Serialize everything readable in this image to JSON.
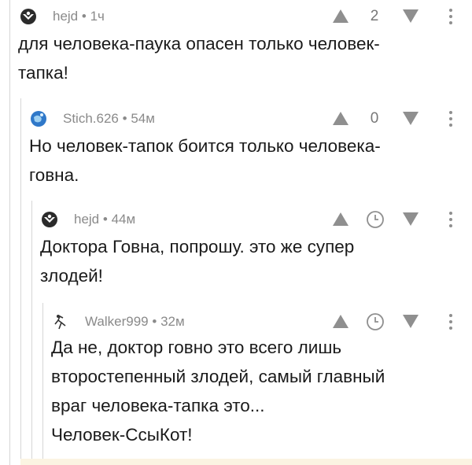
{
  "comments": [
    {
      "author": "hejd",
      "meta": "1ч",
      "rating": "2",
      "avatar": "dark-emblem",
      "lines": [
        "для человека-паука опасен только человек-",
        "тапка!"
      ]
    },
    {
      "author": "Stich.626",
      "meta": "54м",
      "rating": "0",
      "avatar": "blue-globe",
      "lines": [
        "Но человек-тапок боится только человека-",
        "говна."
      ]
    },
    {
      "author": "hejd",
      "meta": "44м",
      "rating": "clock",
      "avatar": "dark-emblem",
      "lines": [
        "Доктора Говна, попрошу. это же супер",
        "злодей!"
      ]
    },
    {
      "author": "Walker999",
      "meta": "32м",
      "rating": "clock",
      "avatar": "sketch-figure",
      "lines": [
        "Да не, доктор говно это всего лишь",
        "второстепенный злодей, самый главный",
        "враг человека-тапка это...",
        "Человек-СсыКот!"
      ]
    }
  ],
  "separator": "•",
  "icons": {
    "upvote": "upvote-triangle-icon",
    "downvote": "downvote-triangle-icon",
    "more": "more-vertical-icon",
    "clock": "clock-icon"
  },
  "colors": {
    "meta_text": "#8a8a8a",
    "icon": "#8f8f8f",
    "thread_line": "#d6d6d6",
    "footer_strip": "#fbf4e2"
  }
}
